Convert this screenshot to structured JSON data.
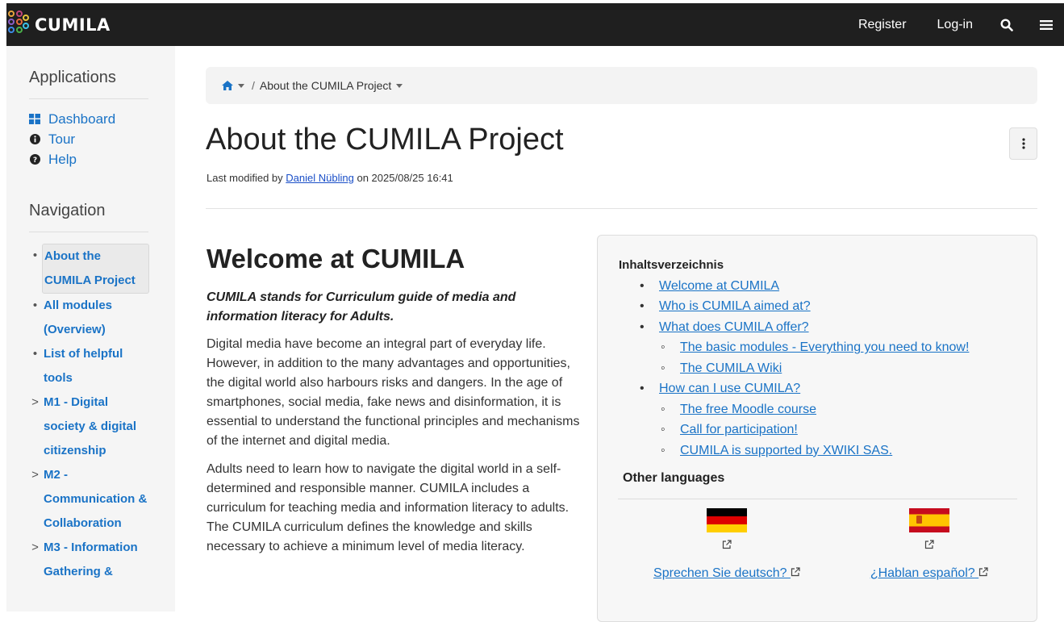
{
  "navbar": {
    "brand": "CUMILA",
    "register": "Register",
    "login": "Log-in",
    "search_icon": "search-icon",
    "menu_icon": "hamburger-menu-icon"
  },
  "sidebar": {
    "applications_heading": "Applications",
    "apps": [
      {
        "label": "Dashboard",
        "icon": "dashboard-icon"
      },
      {
        "label": "Tour",
        "icon": "info-icon"
      },
      {
        "label": "Help",
        "icon": "question-icon"
      }
    ],
    "navigation_heading": "Navigation",
    "nav_items": [
      {
        "label": "About the CUMILA Project",
        "marker": "•",
        "active": true
      },
      {
        "label": "All modules (Overview)",
        "marker": "•"
      },
      {
        "label": "List of helpful tools",
        "marker": "•"
      },
      {
        "label": "M1 - Digital society & digital citizenship",
        "marker": ">"
      },
      {
        "label": "M2 - Communication & Collaboration",
        "marker": ">"
      },
      {
        "label": "M3 - Information Gathering &",
        "marker": ">"
      }
    ]
  },
  "breadcrumb": {
    "home_icon": "home-icon",
    "current": "About the CUMILA Project",
    "separator": "/"
  },
  "page": {
    "title": "About the CUMILA Project",
    "meta_prefix": "Last modified by",
    "meta_author": "Daniel Nübling",
    "meta_suffix": "on 2025/08/25 16:41",
    "more_icon": "more-actions-icon"
  },
  "content": {
    "heading": "Welcome at CUMILA",
    "lead": "CUMILA stands for Curriculum guide of media and information literacy for Adults.",
    "paragraph_1": "Digital media have become an integral part of everyday life. However, in addition to the many advantages and opportunities, the digital world also harbours risks and dangers. In the age of smartphones, social media, fake news and disinformation, it is essential to understand the functional principles and mechanisms of the internet and digital media.",
    "paragraph_2": "Adults need to learn how to navigate the digital world in a self-determined and responsible manner. CUMILA includes a curriculum for teaching media and information literacy to adults. The CUMILA curriculum defines the knowledge and skills necessary to achieve a minimum level of media literacy."
  },
  "toc": {
    "title": "Inhaltsverzeichnis",
    "items": [
      {
        "label": "Welcome at CUMILA",
        "level": 1
      },
      {
        "label": "Who is CUMILA aimed at?",
        "level": 1
      },
      {
        "label": "What does CUMILA offer?",
        "level": 1
      },
      {
        "label": "The basic modules - Everything you need to know!",
        "level": 2
      },
      {
        "label": "The CUMILA Wiki",
        "level": 2
      },
      {
        "label": "How can I use CUMILA?",
        "level": 1
      },
      {
        "label": "The free Moodle course",
        "level": 2
      },
      {
        "label": "Call for participation!",
        "level": 2
      },
      {
        "label": "CUMILA is supported by XWIKI SAS.",
        "level": 2
      }
    ],
    "other_languages_title": "Other languages",
    "languages": [
      {
        "flag": "germany-flag",
        "link": "Sprechen Sie deutsch?"
      },
      {
        "flag": "spain-flag",
        "link": "¿Hablan español?"
      }
    ]
  },
  "colors": {
    "navbar_bg": "#1f1f1f",
    "link": "#1a73c6",
    "sidebar_bg": "#f5f5f5",
    "brand_logo": "#e8a33c"
  }
}
